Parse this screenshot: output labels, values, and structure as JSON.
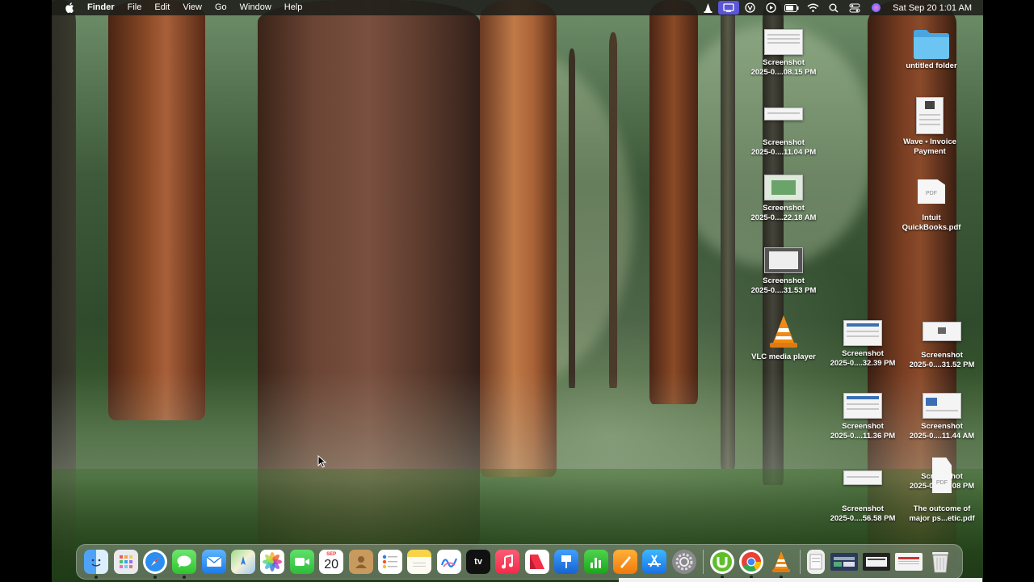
{
  "menubar": {
    "app": "Finder",
    "menus": [
      "File",
      "Edit",
      "View",
      "Go",
      "Window",
      "Help"
    ],
    "status_icons": [
      "vlc-cone-icon",
      "screen-record-icon",
      "extensions-icon",
      "play-circle-icon",
      "battery-icon",
      "wifi-icon",
      "spotlight-search-icon",
      "control-center-icon",
      "siri-icon"
    ],
    "clock": "Sat Sep 20  1:01 AM"
  },
  "desktop": {
    "icons": [
      {
        "name": "Screenshot",
        "sub": "2025-0....08.15 PM",
        "kind": "shot"
      },
      {
        "name": "Screenshot",
        "sub": "2025-0....11.04 PM",
        "kind": "shot"
      },
      {
        "name": "Screenshot",
        "sub": "2025-0....22.18 AM",
        "kind": "shot"
      },
      {
        "name": "Screenshot",
        "sub": "2025-0....31.53 PM",
        "kind": "shot"
      },
      {
        "name": "VLC media player",
        "sub": "",
        "kind": "app"
      },
      {
        "name": "untitled folder",
        "sub": "",
        "kind": "folder"
      },
      {
        "name": "Wave • Invoice",
        "sub": "Payment",
        "kind": "doc"
      },
      {
        "name": "Intuit",
        "sub": "QuickBooks.pdf",
        "kind": "pdf"
      },
      {
        "name": "Screenshot",
        "sub": "2025-0....32.39 PM",
        "kind": "shot"
      },
      {
        "name": "Screenshot",
        "sub": "2025-0....31.52 PM",
        "kind": "shot"
      },
      {
        "name": "Screenshot",
        "sub": "2025-0....11.36 PM",
        "kind": "shot"
      },
      {
        "name": "Screenshot",
        "sub": "2025-0....11.44 AM",
        "kind": "shot"
      },
      {
        "name": "Screenshot",
        "sub": "2025-0....56.58 PM",
        "kind": "shot"
      },
      {
        "name": "Screenshot",
        "sub": "2025-0....11.08 PM",
        "kind": "shot"
      },
      {
        "name": "The outcome of",
        "sub": "major ps...etic.pdf",
        "kind": "pdf"
      }
    ]
  },
  "dock": {
    "calendar_month": "SEP",
    "calendar_day": "20",
    "appletv_label": "tv",
    "apps": [
      "Finder",
      "Launchpad",
      "Safari",
      "Messages",
      "Mail",
      "Maps",
      "Photos",
      "FaceTime",
      "Calendar",
      "Contacts",
      "Reminders",
      "Notes",
      "Freeform",
      "TV",
      "Music",
      "News",
      "Keynote",
      "Numbers",
      "Pages",
      "App Store",
      "System Settings",
      "uTorrent",
      "Chrome",
      "VLC",
      "Downloads",
      "Recent Screenshot 1",
      "Recent Screenshot 2",
      "Recent Screenshot 3",
      "Trash"
    ]
  },
  "colors": {
    "menubar_bg": "#1e1e19",
    "active_status": "#5a56d6",
    "folder_blue": "#5ab8ec"
  }
}
